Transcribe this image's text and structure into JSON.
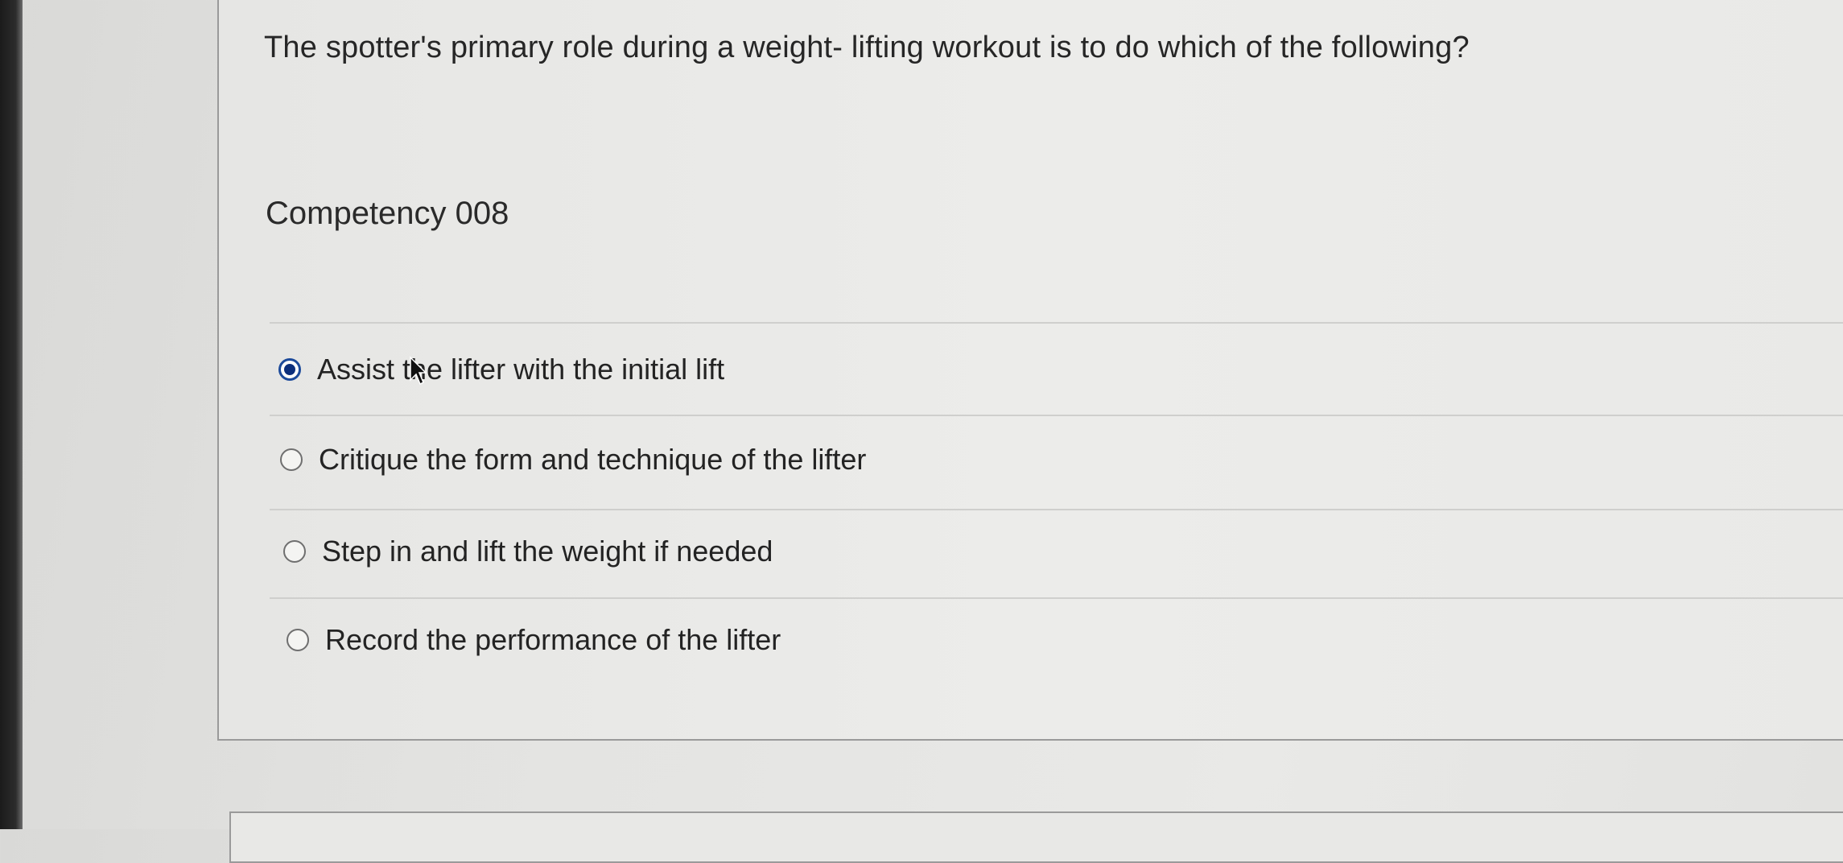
{
  "quiz": {
    "question": "The spotter's primary role during a weight- lifting workout is to do which of the following?",
    "competency": "Competency 008",
    "options": [
      {
        "label": "Assist the lifter with the initial lift",
        "selected": true
      },
      {
        "label": "Critique the form and technique of the lifter",
        "selected": false
      },
      {
        "label": "Step in and lift the weight if needed",
        "selected": false
      },
      {
        "label": "Record the performance of the lifter",
        "selected": false
      }
    ]
  },
  "colors": {
    "selected_radio": "#0c2f7c",
    "page_background": "#e6e6e4"
  },
  "icons": {
    "cursor": "mouse-pointer-icon",
    "radio": "radio-button-icon"
  }
}
